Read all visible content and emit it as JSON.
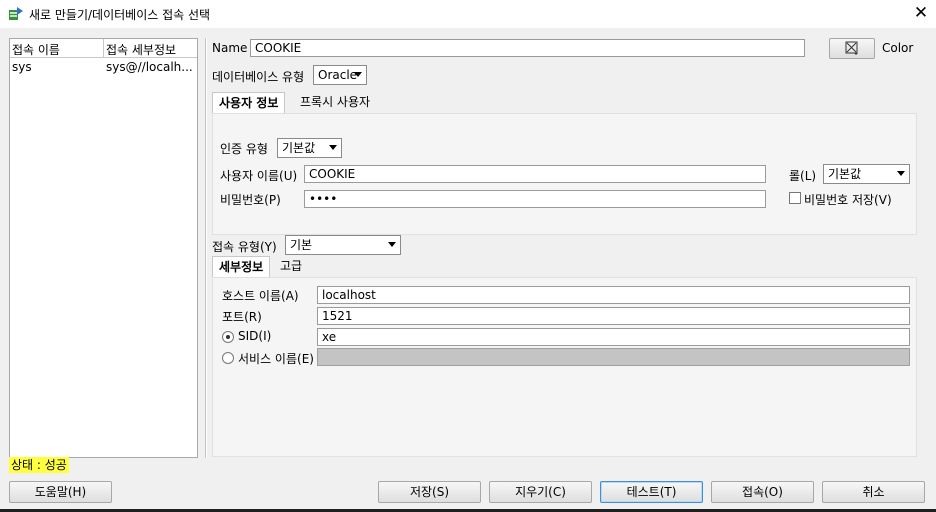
{
  "window": {
    "title": "새로 만들기/데이터베이스 접속 선택",
    "close_symbol": "✕"
  },
  "connections": {
    "headers": [
      "접속 이름",
      "접속 세부정보"
    ],
    "rows": [
      {
        "name": "sys",
        "details": "sys@//localh..."
      }
    ]
  },
  "form": {
    "name_label": "Name",
    "name_value": "COOKIE",
    "color_label": "Color",
    "db_type_label": "데이터베이스 유형",
    "db_type_value": "Oracle",
    "tabs": [
      "사용자 정보",
      "프록시 사용자"
    ],
    "auth_type_label": "인증 유형",
    "auth_type_value": "기본값",
    "username_label": "사용자 이름(U)",
    "username_value": "COOKIE",
    "role_label": "롤(L)",
    "role_value": "기본값",
    "password_label": "비밀번호(P)",
    "password_value": "••••",
    "save_password_label": "비밀번호 저장(V)",
    "conn_type_label": "접속 유형(Y)",
    "conn_type_value": "기본",
    "detail_tabs": [
      "세부정보",
      "고급"
    ],
    "host_label": "호스트 이름(A)",
    "host_value": "localhost",
    "port_label": "포트(R)",
    "port_value": "1521",
    "sid_label": "SID(I)",
    "sid_value": "xe",
    "service_label": "서비스 이름(E)",
    "service_value": ""
  },
  "status": {
    "text": "상태 : 성공"
  },
  "buttons": {
    "help": "도움말(H)",
    "save": "저장(S)",
    "clear": "지우기(C)",
    "test": "테스트(T)",
    "connect": "접속(O)",
    "cancel": "취소"
  },
  "icons": {
    "app": "database-icon",
    "color": "color-picker-icon",
    "close": "close-icon"
  },
  "colors": {
    "status_highlight": "#ffff40",
    "focus_border": "#3f8fd8"
  }
}
